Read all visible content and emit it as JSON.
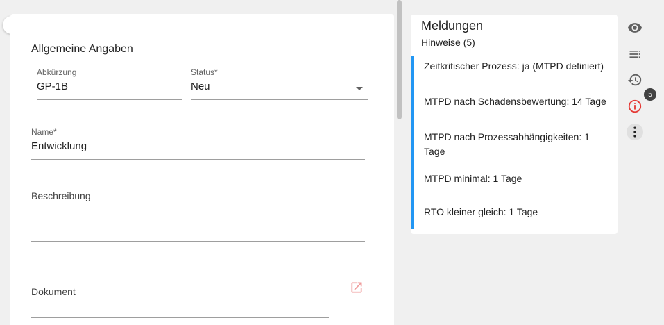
{
  "form": {
    "section_title": "Allgemeine Angaben",
    "abkuerzung": {
      "label": "Abkürzung",
      "value": "GP-1B"
    },
    "status": {
      "label": "Status*",
      "value": "Neu"
    },
    "name": {
      "label": "Name*",
      "value": "Entwicklung"
    },
    "beschreibung": {
      "label": "Beschreibung",
      "value": ""
    },
    "dokument": {
      "label": "Dokument",
      "value": ""
    }
  },
  "messages": {
    "title": "Meldungen",
    "subtitle": "Hinweise (5)",
    "items": [
      "Zeitkritischer Prozess: ja (MTPD definiert)",
      "MTPD nach Schadensbewertung: 14 Tage",
      "MTPD nach Prozessabhängigkeiten: 1 Tage",
      "MTPD minimal: 1 Tage",
      "RTO kleiner gleich: 1 Tage"
    ]
  },
  "toolbar": {
    "icons": [
      "eye-icon",
      "list-icon",
      "history-icon",
      "info-icon",
      "more-vert-icon"
    ],
    "info_badge": "5"
  },
  "colors": {
    "accent_blue": "#2196f3",
    "error_red": "#e53935",
    "link_icon": "#ef9a9a"
  }
}
